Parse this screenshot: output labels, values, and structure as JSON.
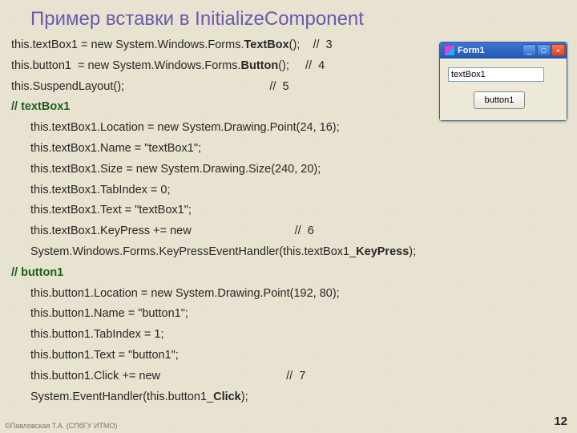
{
  "title": "Пример вставки в InitializeComponent",
  "code": {
    "l1a": "this.textBox1 = new System.Windows.Forms.",
    "l1b": "TextBox",
    "l1c": "();    //  3",
    "l2a": "this.button1  = new System.Windows.Forms.",
    "l2b": "Button",
    "l2c": "();     //  4",
    "l3": "this.SuspendLayout();                                             //  5",
    "s1": "// textBox1",
    "l4": "this.textBox1.Location = new System.Drawing.Point(24, 16);",
    "l5": "this.textBox1.Name = \"textBox1\";",
    "l6": "this.textBox1.Size = new System.Drawing.Size(240, 20);",
    "l7": "this.textBox1.TabIndex = 0;",
    "l8": "this.textBox1.Text = \"textBox1\";",
    "l9": "this.textBox1.KeyPress += new                                //  6",
    "l10a": "System.Windows.Forms.KeyPressEventHandler(this.textBox1_",
    "l10b": "KeyPress",
    "l10c": ");",
    "s2": "// button1",
    "l11": "this.button1.Location = new System.Drawing.Point(192, 80);",
    "l12": "this.button1.Name = \"button1\";",
    "l13": "this.button1.TabIndex = 1;",
    "l14": "this.button1.Text = \"button1\";",
    "l15": "this.button1.Click += new                                       //  7",
    "l16a": "System.EventHandler(this.button1_",
    "l16b": "Click",
    "l16c": ");"
  },
  "mockwin": {
    "title": "Form1",
    "textbox_value": "textBox1",
    "button_label": "button1"
  },
  "footer": "©Павловская Т.А. (СПбГУ ИТМО)",
  "page": "12"
}
